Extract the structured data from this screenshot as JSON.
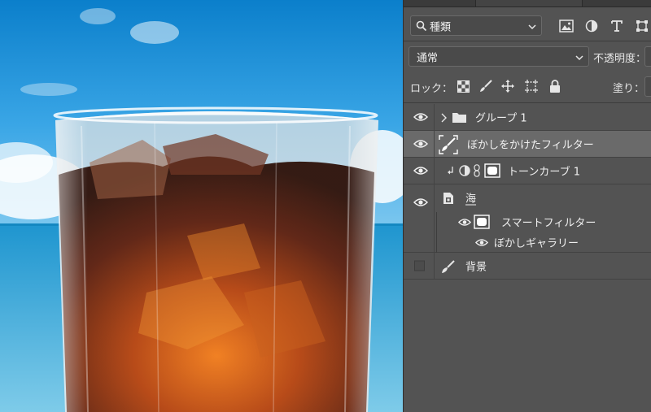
{
  "colors": {
    "panel_bg": "#535353",
    "selected_row": "#6a6a6a",
    "sky_top": "#0f86d0",
    "sea": "#2aa3d9",
    "drink_dark": "#3a150b",
    "drink_orange": "#d9600e"
  },
  "toolbar": {
    "filter_select": {
      "icon": "search-icon",
      "value": "種類"
    },
    "filter_icons": [
      "image-filter-icon",
      "adjustment-filter-icon",
      "text-filter-icon",
      "shape-filter-icon"
    ],
    "blend_mode": "通常",
    "opacity_label": "不透明度：",
    "lock_label": "ロック：",
    "lock_icons": [
      "lock-transparent-icon",
      "lock-pixels-icon",
      "lock-position-icon",
      "lock-artboard-icon",
      "lock-all-icon"
    ],
    "fill_label": "塗り："
  },
  "layers": [
    {
      "name": "グループ 1",
      "kind": "group",
      "visible": true,
      "selected": false
    },
    {
      "name": "ぼかしをかけたフィルター",
      "kind": "brush",
      "visible": true,
      "selected": true
    },
    {
      "name": "トーンカーブ 1",
      "kind": "adjustment",
      "visible": true,
      "selected": false,
      "clipped": true
    },
    {
      "name": "海",
      "kind": "smart-object",
      "visible": true,
      "selected": false
    },
    {
      "name": "スマートフィルター",
      "kind": "smart-filter",
      "visible": true,
      "selected": false
    },
    {
      "name": "ぼかしギャラリー",
      "kind": "filter-item",
      "visible": true,
      "selected": false
    },
    {
      "name": "背景",
      "kind": "background",
      "visible": false,
      "selected": false
    }
  ]
}
